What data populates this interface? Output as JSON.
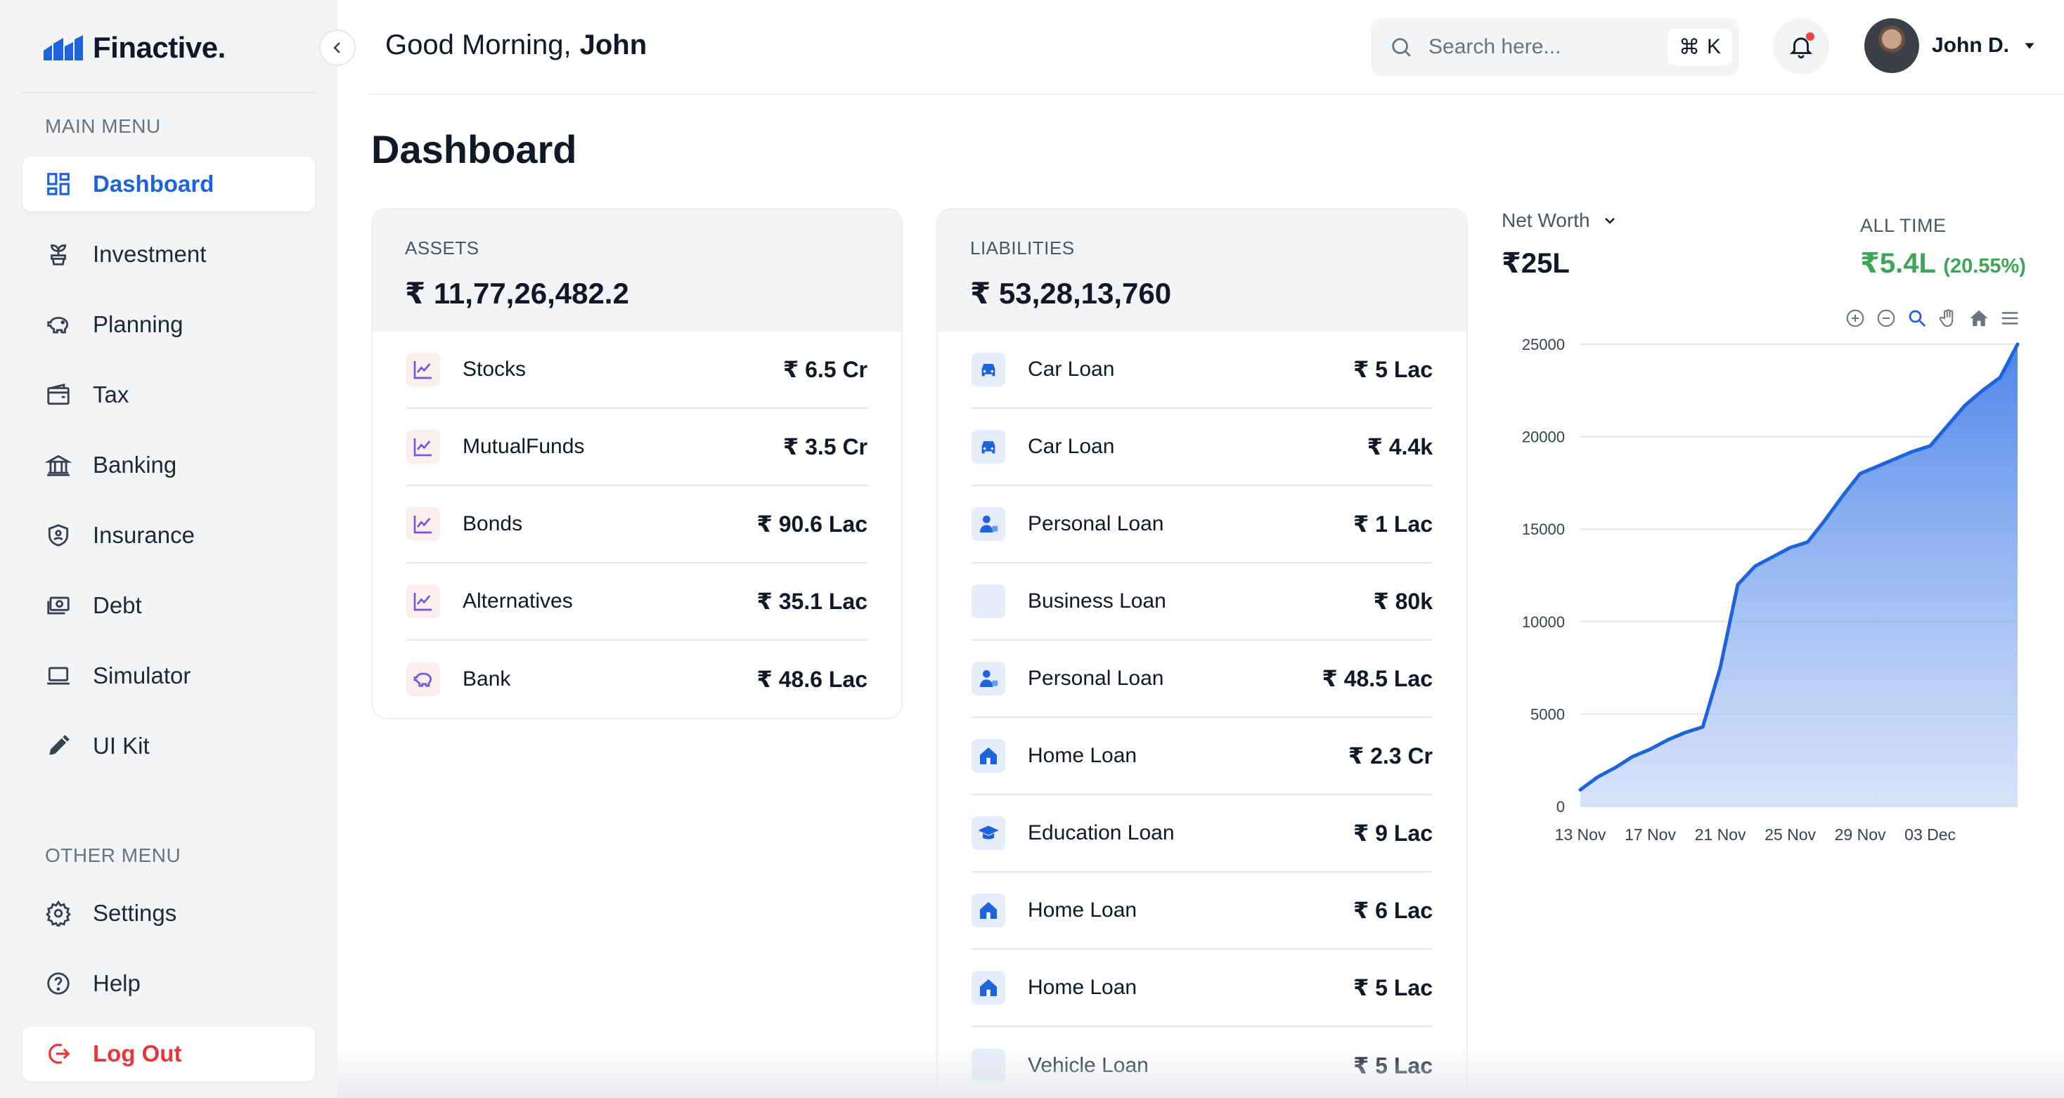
{
  "app": {
    "name": "Finactive."
  },
  "sidebar": {
    "main_heading": "MAIN MENU",
    "main_items": [
      {
        "label": "Dashboard",
        "icon": "dashboard-icon",
        "active": true
      },
      {
        "label": "Investment",
        "icon": "plant-icon"
      },
      {
        "label": "Planning",
        "icon": "piggy-bank-icon"
      },
      {
        "label": "Tax",
        "icon": "wallet-icon"
      },
      {
        "label": "Banking",
        "icon": "bank-icon"
      },
      {
        "label": "Insurance",
        "icon": "shield-icon"
      },
      {
        "label": "Debt",
        "icon": "money-icon"
      },
      {
        "label": "Simulator",
        "icon": "laptop-icon"
      },
      {
        "label": "UI Kit",
        "icon": "pencil-icon"
      }
    ],
    "other_heading": "OTHER MENU",
    "other_items": [
      {
        "label": "Settings",
        "icon": "gear-icon"
      },
      {
        "label": "Help",
        "icon": "help-icon"
      },
      {
        "label": "Log Out",
        "icon": "logout-icon"
      }
    ]
  },
  "header": {
    "greeting": "Good Morning,",
    "user_first_name": "John",
    "search_placeholder": "Search here...",
    "shortcut_symbol": "⌘",
    "shortcut_key": "K",
    "user_name": "John D."
  },
  "page": {
    "title": "Dashboard"
  },
  "assets": {
    "label": "ASSETS",
    "total": "₹ 11,77,26,482.2",
    "items": [
      {
        "name": "Stocks",
        "value": "₹ 6.5 Cr",
        "icon": "trend-icon"
      },
      {
        "name": "MutualFunds",
        "value": "₹ 3.5 Cr",
        "icon": "trend-icon"
      },
      {
        "name": "Bonds",
        "value": "₹ 90.6 Lac",
        "icon": "trend-icon"
      },
      {
        "name": "Alternatives",
        "value": "₹ 35.1 Lac",
        "icon": "trend-icon"
      },
      {
        "name": "Bank",
        "value": "₹ 48.6 Lac",
        "icon": "piggy-bank-icon"
      }
    ]
  },
  "liabilities": {
    "label": "LIABILITIES",
    "total": "₹ 53,28,13,760",
    "items": [
      {
        "name": "Car Loan",
        "value": "₹ 5 Lac",
        "icon": "car-icon"
      },
      {
        "name": "Car Loan",
        "value": "₹ 4.4k",
        "icon": "car-icon"
      },
      {
        "name": "Personal Loan",
        "value": "₹ 1 Lac",
        "icon": "person-icon"
      },
      {
        "name": "Business Loan",
        "value": "₹ 80k",
        "icon": "blank-icon"
      },
      {
        "name": "Personal Loan",
        "value": "₹ 48.5 Lac",
        "icon": "person-icon"
      },
      {
        "name": "Home Loan",
        "value": "₹ 2.3 Cr",
        "icon": "home-icon"
      },
      {
        "name": "Education Loan",
        "value": "₹ 9 Lac",
        "icon": "graduation-cap-icon"
      },
      {
        "name": "Home Loan",
        "value": "₹ 6 Lac",
        "icon": "home-icon"
      },
      {
        "name": "Home Loan",
        "value": "₹ 5 Lac",
        "icon": "home-icon"
      },
      {
        "name": "Vehicle Loan",
        "value": "₹ 5 Lac",
        "icon": "blank-icon"
      }
    ]
  },
  "net_worth": {
    "selector_label": "Net Worth",
    "value": "₹25L",
    "period_label": "ALL TIME",
    "gain": "₹5.4L",
    "gain_pct": "(20.55%)"
  },
  "colors": {
    "accent": "#1d63dc",
    "gain": "#3ea55a",
    "danger": "#e5383b",
    "area": "#bcd0f6"
  },
  "chart_data": {
    "type": "area",
    "title": "",
    "xlabel": "",
    "ylabel": "",
    "ylim": [
      0,
      25000
    ],
    "yticks": [
      0,
      5000,
      10000,
      15000,
      20000,
      25000
    ],
    "x_tick_labels": [
      "13 Nov",
      "17 Nov",
      "21 Nov",
      "25 Nov",
      "29 Nov",
      "03 Dec"
    ],
    "x_start": "2023-11-13",
    "x": [
      "13 Nov",
      "14 Nov",
      "15 Nov",
      "16 Nov",
      "17 Nov",
      "18 Nov",
      "19 Nov",
      "20 Nov",
      "21 Nov",
      "22 Nov",
      "23 Nov",
      "24 Nov",
      "25 Nov",
      "26 Nov",
      "27 Nov",
      "28 Nov",
      "29 Nov",
      "30 Nov",
      "01 Dec",
      "02 Dec",
      "03 Dec",
      "04 Dec",
      "05 Dec",
      "06 Dec",
      "07 Dec",
      "08 Dec"
    ],
    "series": [
      {
        "values": [
          900,
          1600,
          2100,
          2700,
          3100,
          3600,
          4000,
          4300,
          7500,
          12000,
          13000,
          13500,
          14000,
          14300,
          15500,
          16800,
          18000,
          18400,
          18800,
          19200,
          19500,
          20600,
          21700,
          22500,
          23200,
          25000
        ]
      }
    ],
    "grid": true,
    "legend": "none"
  }
}
